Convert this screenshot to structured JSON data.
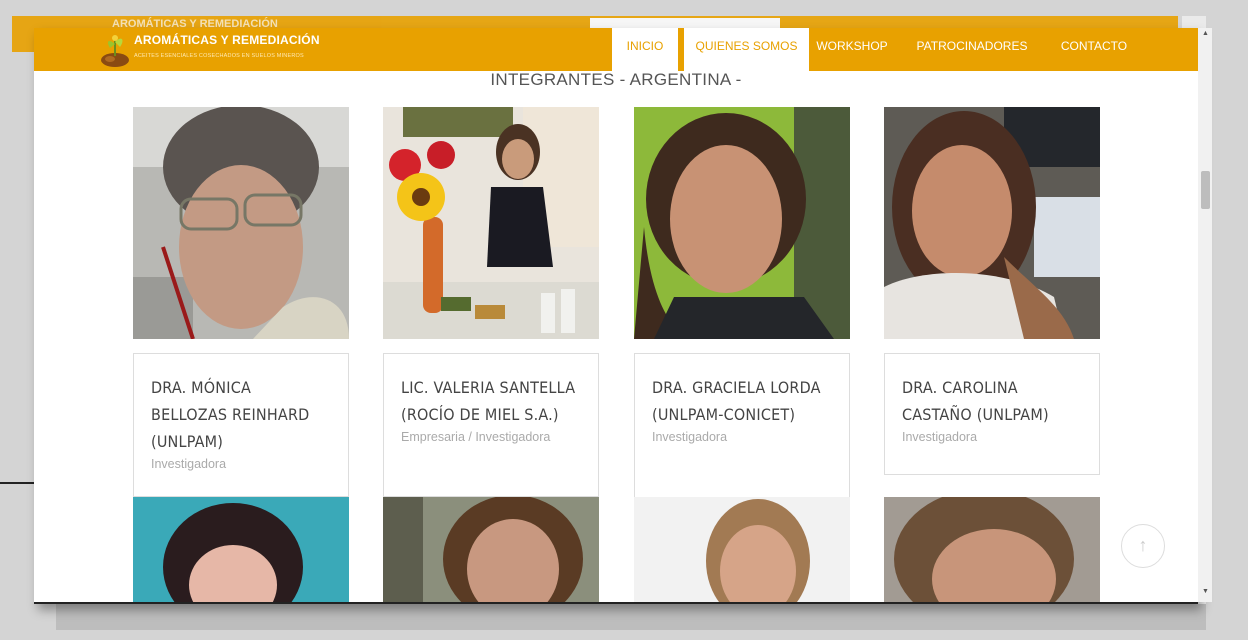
{
  "site": {
    "title": "AROMÁTICAS Y REMEDIACIÓN",
    "subtitle": "ACEITES ESENCIALES COSECHADOS EN SUELOS MINEROS",
    "ghost_title": "AROMÁTICAS Y REMEDIACIÓN"
  },
  "nav": [
    {
      "label": "INICIO"
    },
    {
      "label": "QUIENES SOMOS"
    },
    {
      "label": "WORKSHOP"
    },
    {
      "label": "PATROCINADORES"
    },
    {
      "label": "CONTACTO"
    }
  ],
  "section_title": "INTEGRANTES - ARGENTINA -",
  "members": [
    {
      "name": "DRA. MÓNICA BELLOZAS REINHARD (UNLPAM)",
      "role": "Investigadora"
    },
    {
      "name": "LIC. VALERIA SANTELLA (ROCÍO DE MIEL S.A.)",
      "role": "Empresaria / Investigadora"
    },
    {
      "name": "DRA. GRACIELA LORDA (UNLPAM-CONICET)",
      "role": "Investigadora"
    },
    {
      "name": "DRA. CAROLINA CASTAÑO (UNLPAM)",
      "role": "Investigadora"
    }
  ],
  "colors": {
    "brand": "#e8a100",
    "nav_active_text": "#e8a100"
  },
  "icons": {
    "back_to_top": "↑",
    "scroll_up": "▲",
    "scroll_down": "▼"
  }
}
